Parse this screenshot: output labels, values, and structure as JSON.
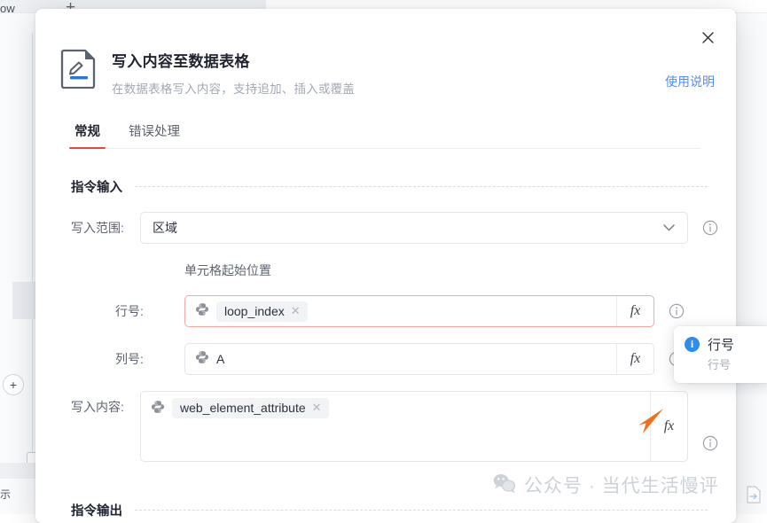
{
  "background": {
    "window_label": "ow",
    "new_tab_icon": "plus-icon",
    "add_node_label": "+",
    "foot_label": "示"
  },
  "modal": {
    "close_icon": "close-icon",
    "doc_icon": "document-edit-icon",
    "title": "写入内容至数据表格",
    "subtitle": "在数据表格写入内容，支持追加、插入或覆盖",
    "help_link": "使用说明",
    "tabs": [
      {
        "label": "常规",
        "active": true
      },
      {
        "label": "错误处理",
        "active": false
      }
    ],
    "sections": {
      "input": {
        "title": "指令输入",
        "scope": {
          "label": "写入范围:",
          "value": "区域",
          "chevron_icon": "chevron-down-icon",
          "info_icon": "info-circle-icon"
        },
        "cell_start_caption": "单元格起始位置",
        "row": {
          "label": "行号:",
          "var_icon": "python-icon",
          "chip": "loop_index",
          "chip_close_icon": "close-small-icon",
          "fx_label": "fx",
          "info_icon": "info-circle-icon",
          "has_error": true
        },
        "column": {
          "label": "列号:",
          "var_icon": "python-icon",
          "value": "A",
          "fx_label": "fx",
          "info_icon": "info-circle-icon"
        },
        "content": {
          "label": "写入内容:",
          "var_icon": "python-icon",
          "chip": "web_element_attribute",
          "chip_close_icon": "close-small-icon",
          "fx_label": "fx",
          "info_icon": "info-circle-icon"
        }
      },
      "output": {
        "title": "指令输出"
      }
    }
  },
  "tooltip": {
    "badge": "i",
    "title": "行号",
    "subtitle": "行号"
  },
  "watermark": {
    "icon": "wechat-icon",
    "text": "公众号 · 当代生活慢评"
  },
  "colors": {
    "accent_red": "#e8463c",
    "link_blue": "#4d8ef7",
    "info_blue": "#2d8cf0",
    "error_border": "#f3a9a4",
    "cursor_orange": "#f07020"
  }
}
